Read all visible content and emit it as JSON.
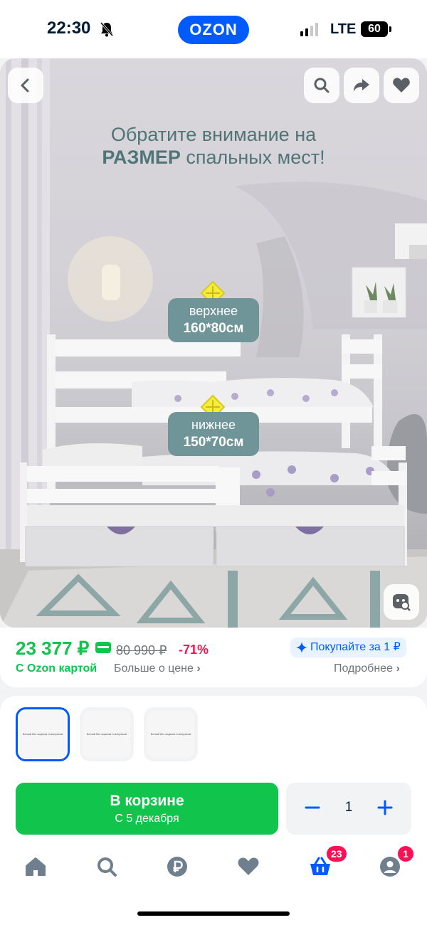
{
  "status_bar": {
    "time": "22:30",
    "network": "LTE",
    "battery": "60"
  },
  "header": {
    "logo": "OZON"
  },
  "gallery": {
    "headline_line1": "Обратите внимание на",
    "headline_line2_bold": "РАЗМЕР",
    "headline_line2_rest": " спальных мест",
    "headline_line2_end": "!",
    "upper_label": "верхнее",
    "upper_size": "160*80см",
    "lower_label": "нижнее",
    "lower_size": "150*70см",
    "buttons": [
      "back-icon",
      "search-icon",
      "share-icon",
      "heart-icon",
      "visual-search-icon"
    ]
  },
  "price": {
    "current": "23 377 ₽",
    "old": "80 990 ₽",
    "discount": "-71%",
    "ozon_card_label": "С Ozon картой",
    "more_price_label": "Больше о цене",
    "promo_label": "Покупайте за 1 ₽",
    "details_label": "Подробнее"
  },
  "variants": [
    {
      "caption": "Белый без ящиков и матрасов",
      "selected": true
    },
    {
      "caption": "Белый без ящиков и матрасов",
      "selected": false
    },
    {
      "caption": "Белый без ящиков и матрасов",
      "selected": false
    }
  ],
  "cart": {
    "label": "В корзине",
    "delivery": "С 5 декабря",
    "quantity": "1"
  },
  "tabbar": {
    "items": [
      "home-icon",
      "search-icon",
      "ruble-icon",
      "favorites-icon",
      "cart-icon",
      "profile-icon"
    ],
    "cart_badge": "23",
    "profile_badge": "1"
  },
  "colors": {
    "brand": "#005bff",
    "price_green": "#10c44c",
    "discount": "#f91155"
  }
}
